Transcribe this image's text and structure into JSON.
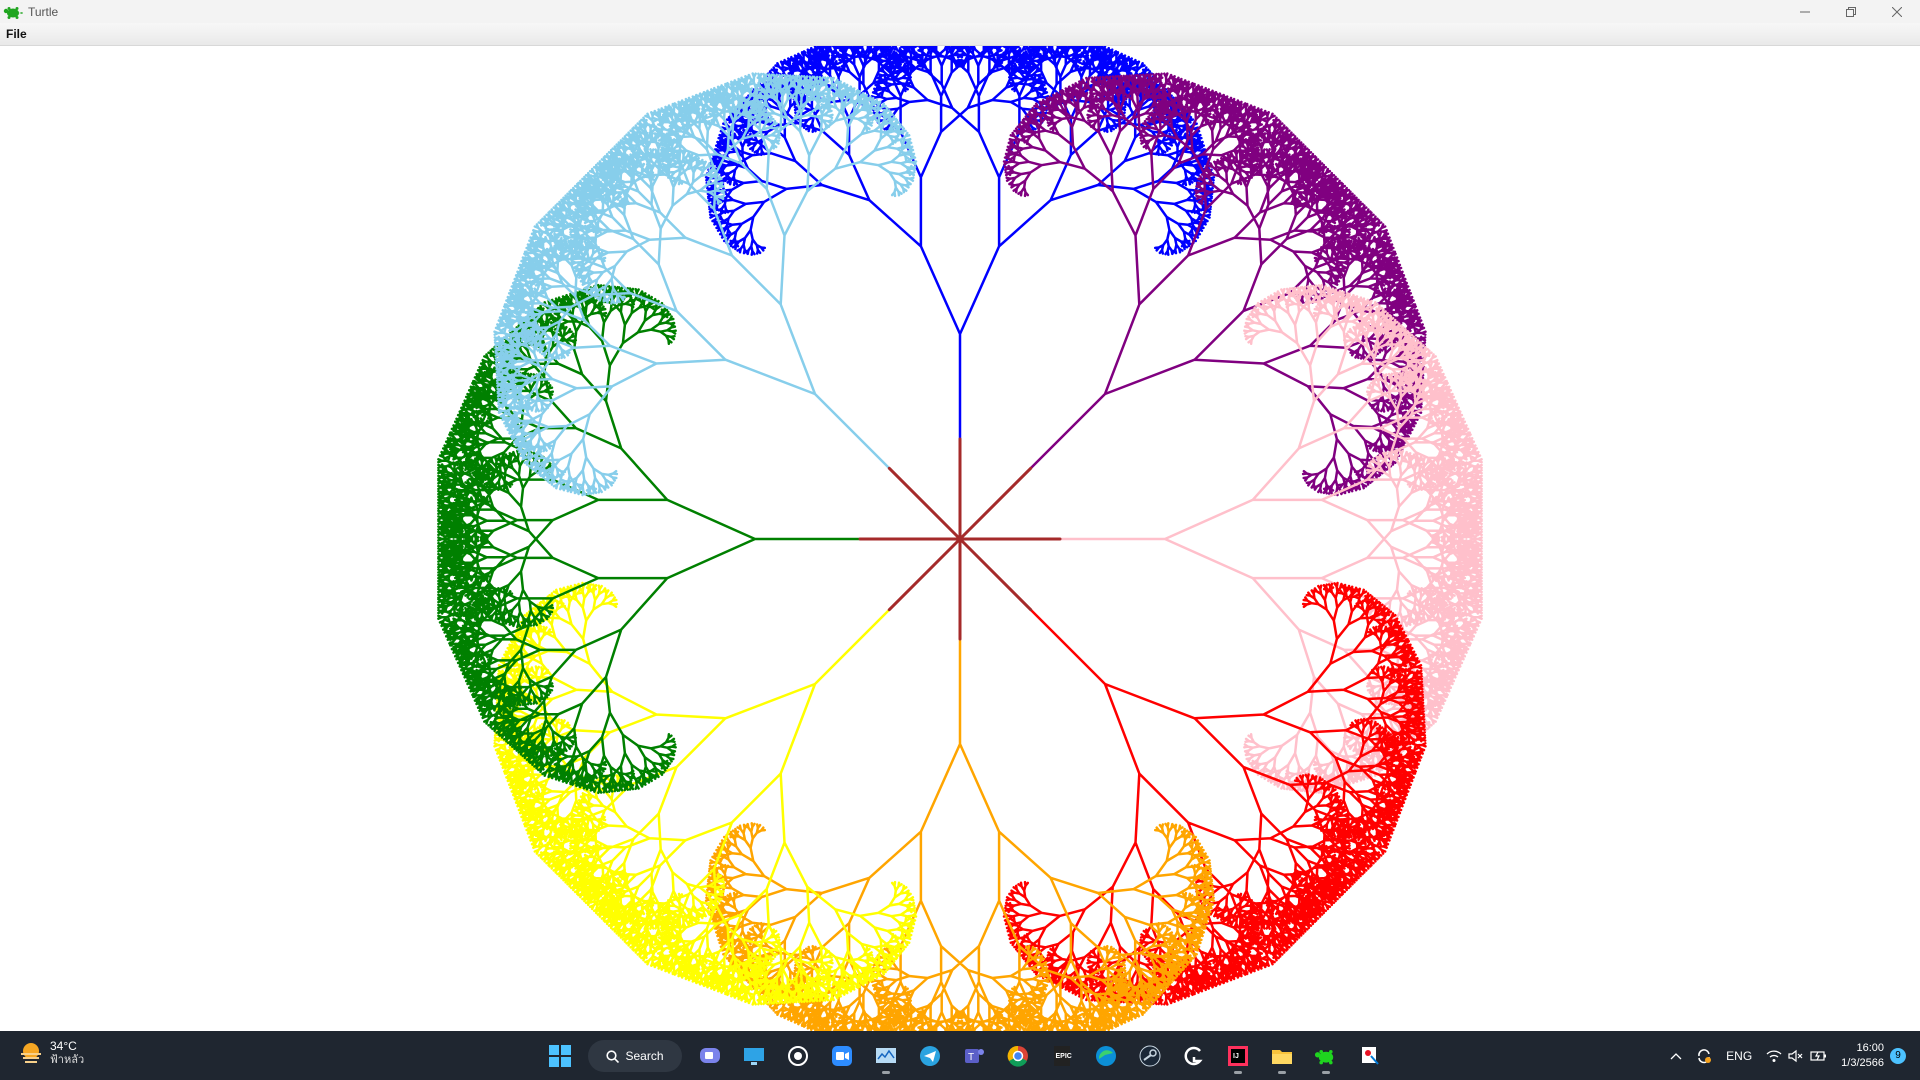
{
  "window": {
    "title": "Turtle",
    "controls": {
      "minimize": "minimize-icon",
      "restore": "restore-icon",
      "close": "close-icon"
    }
  },
  "menu": {
    "items": [
      "File"
    ]
  },
  "drawing": {
    "description_colors": [
      "#0000ff",
      "#800080",
      "#ffc0cb",
      "#ff0000",
      "#ffa500",
      "#ffff00",
      "#008000",
      "#87ceeb"
    ],
    "trunk_color": "#a52a2a",
    "tree_count": 8
  },
  "taskbar": {
    "weather": {
      "temp": "34°C",
      "condition": "ฟ้าหลัว"
    },
    "search_label": "Search",
    "apps": [
      "windows-start-icon",
      "search",
      "chat-icon",
      "desktop-icon",
      "steam-settings-icon",
      "zoom-icon",
      "monitor-app-icon",
      "telegram-icon",
      "teams-icon",
      "chrome-icon",
      "epic-games-icon",
      "edge-icon",
      "steam-icon",
      "logitech-icon",
      "intellij-icon",
      "file-explorer-icon",
      "python-turtle-icon",
      "snipping-tool-icon"
    ],
    "tray": {
      "language": "ENG",
      "time": "16:00",
      "date": "1/3/2566",
      "notifications": "9"
    }
  }
}
